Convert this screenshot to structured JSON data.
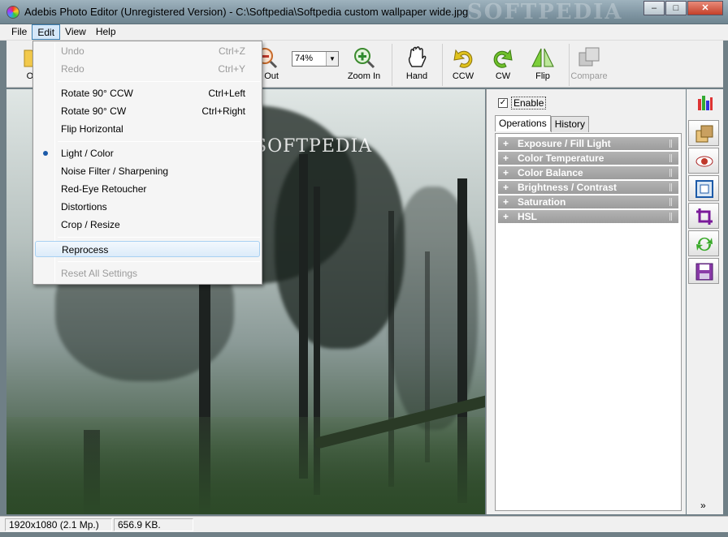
{
  "window": {
    "title": "Adebis Photo Editor (Unregistered Version) - C:\\Softpedia\\Softpedia custom wallpaper wide.jpg",
    "watermark": "SOFTPEDIA",
    "controls": {
      "minimize": "–",
      "maximize": "□",
      "close": "✕"
    }
  },
  "menubar": [
    "File",
    "Edit",
    "View",
    "Help"
  ],
  "toolbar": {
    "open_label": "Op",
    "zoom_out_label": "m Out",
    "zoom_value": "74%",
    "zoom_in_label": "Zoom In",
    "hand_label": "Hand",
    "ccw_label": "CCW",
    "cw_label": "CW",
    "flip_label": "Flip",
    "compare_label": "Compare"
  },
  "edit_menu": {
    "items": [
      {
        "label": "Undo",
        "shortcut": "Ctrl+Z",
        "disabled": true
      },
      {
        "label": "Redo",
        "shortcut": "Ctrl+Y",
        "disabled": true
      },
      {
        "label": "Rotate 90° CCW",
        "shortcut": "Ctrl+Left"
      },
      {
        "label": "Rotate 90° CW",
        "shortcut": "Ctrl+Right"
      },
      {
        "label": "Flip Horizontal",
        "shortcut": ""
      },
      {
        "label": "Light / Color",
        "shortcut": "",
        "selected": true
      },
      {
        "label": "Noise Filter / Sharpening",
        "shortcut": ""
      },
      {
        "label": "Red-Eye Retoucher",
        "shortcut": ""
      },
      {
        "label": "Distortions",
        "shortcut": ""
      },
      {
        "label": "Crop / Resize",
        "shortcut": ""
      },
      {
        "label": "Reprocess",
        "shortcut": "",
        "highlighted": true
      },
      {
        "label": "Reset All Settings",
        "shortcut": "",
        "disabled": true
      }
    ]
  },
  "canvas": {
    "watermark": "SOFTPEDIA"
  },
  "panel": {
    "enable_label": "Enable",
    "enable_checked": "✓",
    "tabs": [
      "Operations",
      "History"
    ],
    "operations": [
      "Exposure / Fill Light",
      "Color Temperature",
      "Color Balance",
      "Brightness / Contrast",
      "Saturation",
      "HSL"
    ],
    "plus": "+",
    "more": "»"
  },
  "statusbar": {
    "resolution": "1920x1080 (2.1 Mp.)",
    "filesize": "656.9 KB."
  },
  "colors": {
    "accent": "#3c7fb1",
    "op_header": "#a8a8a8"
  }
}
